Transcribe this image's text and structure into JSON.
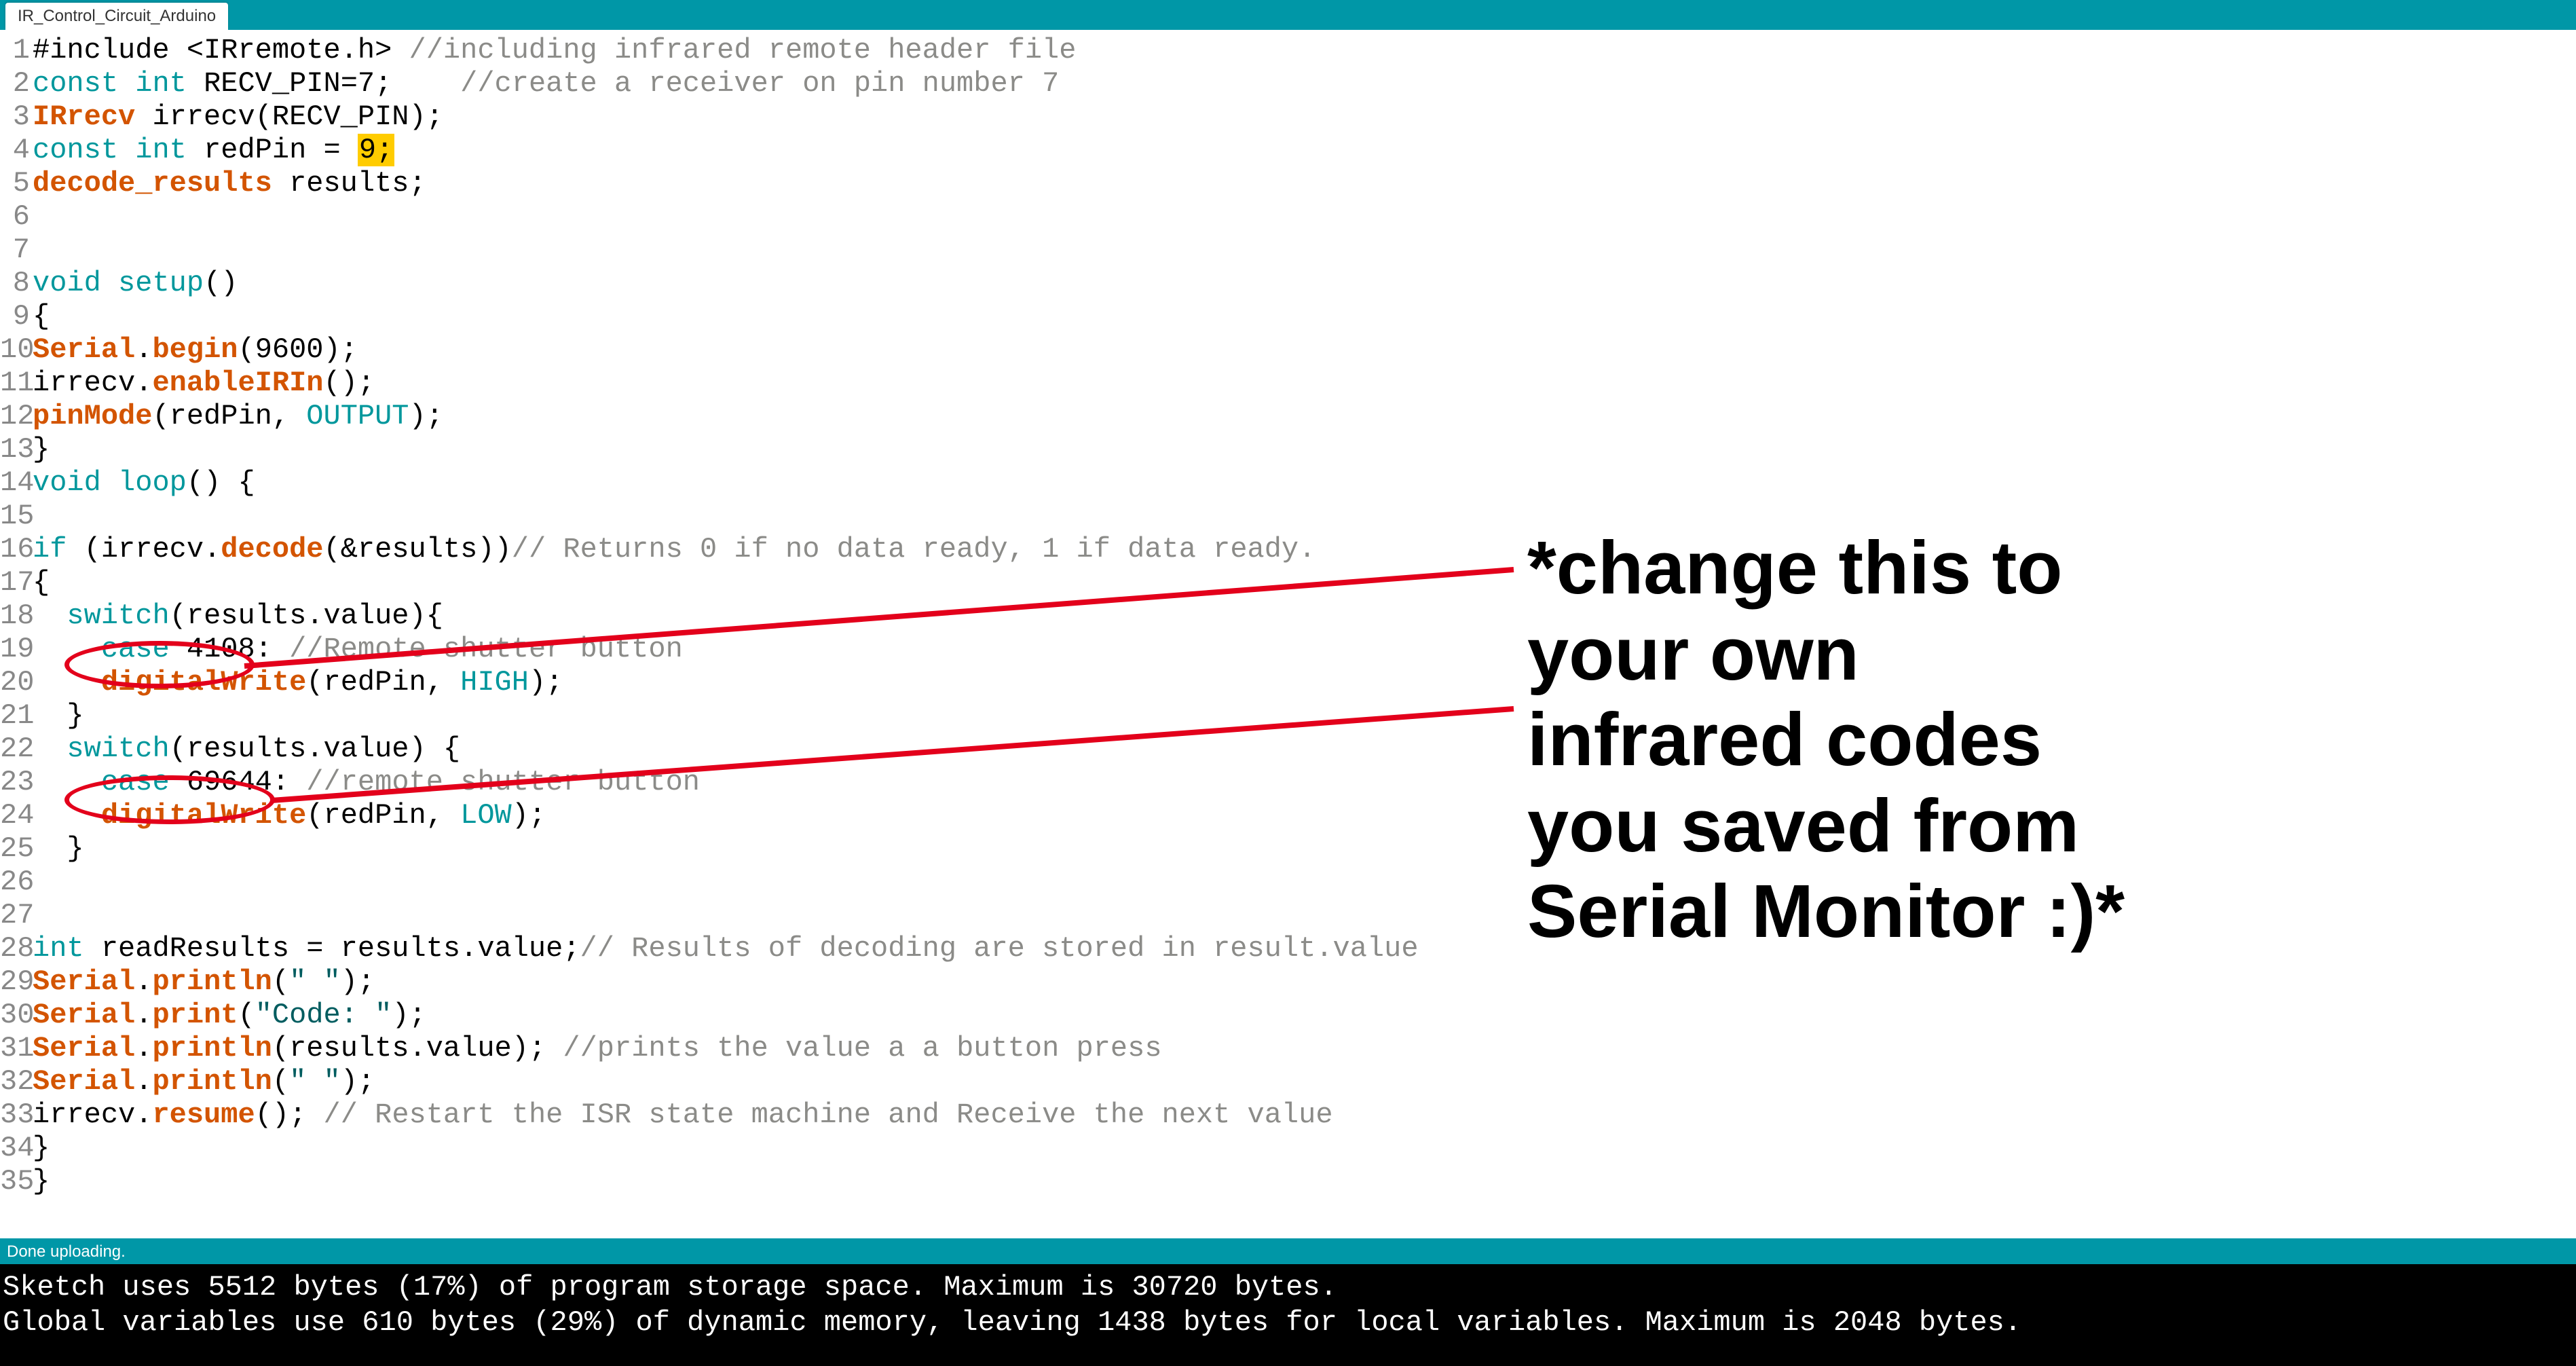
{
  "tab": {
    "title": "IR_Control_Circuit_Arduino"
  },
  "lines": [
    {
      "n": 1,
      "tokens": [
        [
          "",
          "#include <IRremote.h> "
        ],
        [
          "comment",
          "//including infrared remote header file"
        ]
      ]
    },
    {
      "n": 2,
      "tokens": [
        [
          "kw",
          "const "
        ],
        [
          "type",
          "int"
        ],
        [
          "",
          " RECV_PIN=7;    "
        ],
        [
          "comment",
          "//create a receiver on pin number 7"
        ]
      ]
    },
    {
      "n": 3,
      "tokens": [
        [
          "fn",
          "IRrecv"
        ],
        [
          "",
          " irrecv(RECV_PIN);"
        ]
      ]
    },
    {
      "n": 4,
      "tokens": [
        [
          "kw",
          "const "
        ],
        [
          "type",
          "int"
        ],
        [
          "",
          " redPin = "
        ],
        [
          "hl",
          "9;"
        ]
      ]
    },
    {
      "n": 5,
      "tokens": [
        [
          "fn",
          "decode_results"
        ],
        [
          "",
          " results;"
        ]
      ]
    },
    {
      "n": 6,
      "tokens": [
        [
          "",
          ""
        ]
      ]
    },
    {
      "n": 7,
      "tokens": [
        [
          "",
          ""
        ]
      ]
    },
    {
      "n": 8,
      "tokens": [
        [
          "type",
          "void "
        ],
        [
          "kw",
          "setup"
        ],
        [
          "",
          "()"
        ]
      ]
    },
    {
      "n": 9,
      "tokens": [
        [
          "",
          "{"
        ]
      ]
    },
    {
      "n": 10,
      "tokens": [
        [
          "fn",
          "Serial"
        ],
        [
          "",
          "."
        ],
        [
          "fn",
          "begin"
        ],
        [
          "",
          "(9600);"
        ]
      ]
    },
    {
      "n": 11,
      "tokens": [
        [
          "",
          "irrecv."
        ],
        [
          "fn",
          "enableIRIn"
        ],
        [
          "",
          "();"
        ]
      ]
    },
    {
      "n": 12,
      "tokens": [
        [
          "fn",
          "pinMode"
        ],
        [
          "",
          "(redPin, "
        ],
        [
          "const",
          "OUTPUT"
        ],
        [
          "",
          ");"
        ]
      ]
    },
    {
      "n": 13,
      "tokens": [
        [
          "",
          "}"
        ]
      ]
    },
    {
      "n": 14,
      "tokens": [
        [
          "type",
          "void "
        ],
        [
          "kw",
          "loop"
        ],
        [
          "",
          "() {"
        ]
      ]
    },
    {
      "n": 15,
      "tokens": [
        [
          "",
          ""
        ]
      ]
    },
    {
      "n": 16,
      "tokens": [
        [
          "kw",
          "if"
        ],
        [
          "",
          " (irrecv."
        ],
        [
          "fn",
          "decode"
        ],
        [
          "",
          "(&results))"
        ],
        [
          "comment",
          "// Returns 0 if no data ready, 1 if data ready."
        ]
      ]
    },
    {
      "n": 17,
      "tokens": [
        [
          "",
          "{"
        ]
      ]
    },
    {
      "n": 18,
      "tokens": [
        [
          "",
          "  "
        ],
        [
          "kw",
          "switch"
        ],
        [
          "",
          "(results.value){"
        ]
      ]
    },
    {
      "n": 19,
      "tokens": [
        [
          "",
          "    "
        ],
        [
          "kw",
          "case"
        ],
        [
          "",
          " 4108: "
        ],
        [
          "comment",
          "//Remote shutter button"
        ]
      ]
    },
    {
      "n": 20,
      "tokens": [
        [
          "",
          "    "
        ],
        [
          "fn",
          "digitalWrite"
        ],
        [
          "",
          "(redPin, "
        ],
        [
          "const",
          "HIGH"
        ],
        [
          "",
          ");"
        ]
      ]
    },
    {
      "n": 21,
      "tokens": [
        [
          "",
          "  }"
        ]
      ]
    },
    {
      "n": 22,
      "tokens": [
        [
          "",
          "  "
        ],
        [
          "kw",
          "switch"
        ],
        [
          "",
          "(results.value) {"
        ]
      ]
    },
    {
      "n": 23,
      "tokens": [
        [
          "",
          "    "
        ],
        [
          "kw",
          "case"
        ],
        [
          "",
          " 69644: "
        ],
        [
          "comment",
          "//remote shutter button"
        ]
      ]
    },
    {
      "n": 24,
      "tokens": [
        [
          "",
          "    "
        ],
        [
          "fn",
          "digitalWrite"
        ],
        [
          "",
          "(redPin, "
        ],
        [
          "const",
          "LOW"
        ],
        [
          "",
          ");"
        ]
      ]
    },
    {
      "n": 25,
      "tokens": [
        [
          "",
          "  }"
        ]
      ]
    },
    {
      "n": 26,
      "tokens": [
        [
          "",
          ""
        ]
      ]
    },
    {
      "n": 27,
      "tokens": [
        [
          "",
          ""
        ]
      ]
    },
    {
      "n": 28,
      "tokens": [
        [
          "type",
          "int"
        ],
        [
          "",
          " readResults = results.value;"
        ],
        [
          "comment",
          "// Results of decoding are stored in result.value"
        ]
      ]
    },
    {
      "n": 29,
      "tokens": [
        [
          "fn",
          "Serial"
        ],
        [
          "",
          "."
        ],
        [
          "fn",
          "println"
        ],
        [
          "",
          "("
        ],
        [
          "str",
          "\" \""
        ],
        [
          "",
          ");"
        ]
      ]
    },
    {
      "n": 30,
      "tokens": [
        [
          "fn",
          "Serial"
        ],
        [
          "",
          "."
        ],
        [
          "fn",
          "print"
        ],
        [
          "",
          "("
        ],
        [
          "str",
          "\"Code: \""
        ],
        [
          "",
          ");"
        ]
      ]
    },
    {
      "n": 31,
      "tokens": [
        [
          "fn",
          "Serial"
        ],
        [
          "",
          "."
        ],
        [
          "fn",
          "println"
        ],
        [
          "",
          "(results.value); "
        ],
        [
          "comment",
          "//prints the value a a button press"
        ]
      ]
    },
    {
      "n": 32,
      "tokens": [
        [
          "fn",
          "Serial"
        ],
        [
          "",
          "."
        ],
        [
          "fn",
          "println"
        ],
        [
          "",
          "("
        ],
        [
          "str",
          "\" \""
        ],
        [
          "",
          ");"
        ]
      ]
    },
    {
      "n": 33,
      "tokens": [
        [
          "",
          "irrecv."
        ],
        [
          "fn",
          "resume"
        ],
        [
          "",
          "(); "
        ],
        [
          "comment",
          "// Restart the ISR state machine and Receive the next value"
        ]
      ]
    },
    {
      "n": 34,
      "tokens": [
        [
          "",
          "}"
        ]
      ]
    },
    {
      "n": 35,
      "tokens": [
        [
          "",
          "}"
        ]
      ]
    }
  ],
  "status": {
    "text": "Done uploading."
  },
  "console": {
    "l1": "Sketch uses 5512 bytes (17%) of program storage space. Maximum is 30720 bytes.",
    "l2": "Global variables use 610 bytes (29%) of dynamic memory, leaving 1438 bytes for local variables. Maximum is 2048 bytes."
  },
  "annotation": {
    "note_l1": "*change this to",
    "note_l2": "your own",
    "note_l3": "infrared codes",
    "note_l4": "you saved from",
    "note_l5": "Serial Monitor :)*"
  }
}
